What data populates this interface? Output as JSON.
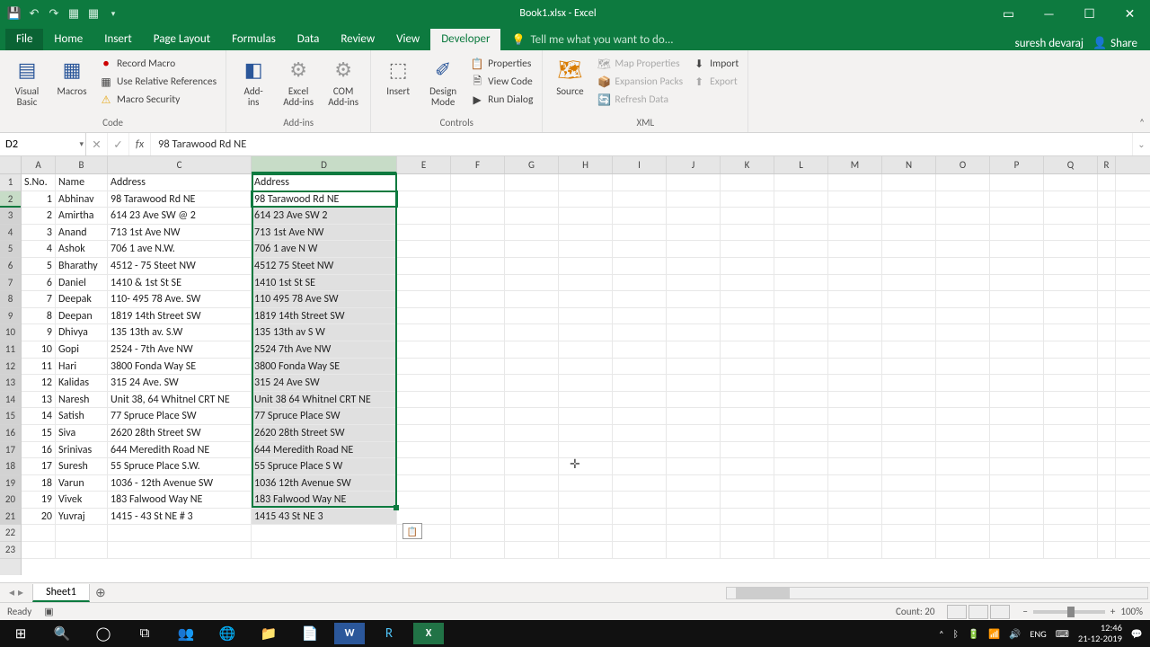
{
  "title": "Book1.xlsx - Excel",
  "user": "suresh devaraj",
  "share": "Share",
  "tabs": [
    "File",
    "Home",
    "Insert",
    "Page Layout",
    "Formulas",
    "Data",
    "Review",
    "View",
    "Developer"
  ],
  "active_tab": "Developer",
  "tellme": "Tell me what you want to do...",
  "ribbon": {
    "code": {
      "vb": "Visual\nBasic",
      "macros": "Macros",
      "record": "Record Macro",
      "relref": "Use Relative References",
      "security": "Macro Security",
      "label": "Code"
    },
    "addins": {
      "addins": "Add-\nins",
      "excel": "Excel\nAdd-ins",
      "com": "COM\nAdd-ins",
      "label": "Add-ins"
    },
    "controls": {
      "insert": "Insert",
      "design": "Design\nMode",
      "properties": "Properties",
      "viewcode": "View Code",
      "rundialog": "Run Dialog",
      "label": "Controls"
    },
    "xml": {
      "source": "Source",
      "mapprops": "Map Properties",
      "expansion": "Expansion Packs",
      "refresh": "Refresh Data",
      "import": "Import",
      "export": "Export",
      "label": "XML"
    }
  },
  "namebox": "D2",
  "formula": "98 Tarawood Rd NE",
  "columns": [
    "A",
    "B",
    "C",
    "D",
    "E",
    "F",
    "G",
    "H",
    "I",
    "J",
    "K",
    "L",
    "M",
    "N",
    "O",
    "P",
    "Q",
    "R"
  ],
  "headers": {
    "A": "S.No.",
    "B": "Name",
    "C": "Address",
    "D": "Address"
  },
  "rows": [
    {
      "n": 1,
      "name": "Abhinav",
      "c": "98 Tarawood Rd NE",
      "d": "98 Tarawood Rd NE"
    },
    {
      "n": 2,
      "name": "Amirtha",
      "c": "614 23 Ave SW @ 2",
      "d": "614 23 Ave SW   2"
    },
    {
      "n": 3,
      "name": "Anand",
      "c": "713 1st Ave NW",
      "d": "713 1st Ave NW"
    },
    {
      "n": 4,
      "name": "Ashok",
      "c": "706 1 ave N.W.",
      "d": "706 1 ave N W"
    },
    {
      "n": 5,
      "name": "Bharathy",
      "c": "4512 - 75 Steet NW",
      "d": "4512   75 Steet NW"
    },
    {
      "n": 6,
      "name": "Daniel",
      "c": "1410 & 1st St SE",
      "d": "1410   1st St SE"
    },
    {
      "n": 7,
      "name": "Deepak",
      "c": "110- 495 78 Ave. SW",
      "d": "110  495 78 Ave  SW"
    },
    {
      "n": 8,
      "name": "Deepan",
      "c": "1819 14th Street SW",
      "d": "1819 14th Street SW"
    },
    {
      "n": 9,
      "name": "Dhivya",
      "c": "135 13th av. S.W",
      "d": "135 13th av  S W"
    },
    {
      "n": 10,
      "name": "Gopi",
      "c": "2524 - 7th Ave NW",
      "d": "2524   7th Ave NW"
    },
    {
      "n": 11,
      "name": "Hari",
      "c": "3800 Fonda Way SE",
      "d": "3800 Fonda Way SE"
    },
    {
      "n": 12,
      "name": "Kalidas",
      "c": "315 24 Ave. SW",
      "d": "315 24 Ave  SW"
    },
    {
      "n": 13,
      "name": "Naresh",
      "c": "Unit 38, 64 Whitnel CRT NE",
      "d": "Unit 38  64 Whitnel CRT NE"
    },
    {
      "n": 14,
      "name": "Satish",
      "c": "77 Spruce Place SW",
      "d": "77 Spruce Place SW"
    },
    {
      "n": 15,
      "name": "Siva",
      "c": "2620 28th Street SW",
      "d": "2620 28th Street SW"
    },
    {
      "n": 16,
      "name": "Srinivas",
      "c": "644 Meredith Road NE",
      "d": "644 Meredith Road NE"
    },
    {
      "n": 17,
      "name": "Suresh",
      "c": "55 Spruce Place S.W.",
      "d": "55 Spruce Place S W"
    },
    {
      "n": 18,
      "name": "Varun",
      "c": "1036 - 12th Avenue SW",
      "d": "1036   12th Avenue SW"
    },
    {
      "n": 19,
      "name": "Vivek",
      "c": "183 Falwood Way NE",
      "d": "183 Falwood Way NE"
    },
    {
      "n": 20,
      "name": "Yuvraj",
      "c": "1415 - 43 St NE # 3",
      "d": "1415   43 St NE   3"
    }
  ],
  "sheet": "Sheet1",
  "status": {
    "ready": "Ready",
    "count": "Count: 20",
    "zoom": "100%"
  },
  "system": {
    "lang": "ENG",
    "time": "12:46",
    "date": "21-12-2019"
  }
}
